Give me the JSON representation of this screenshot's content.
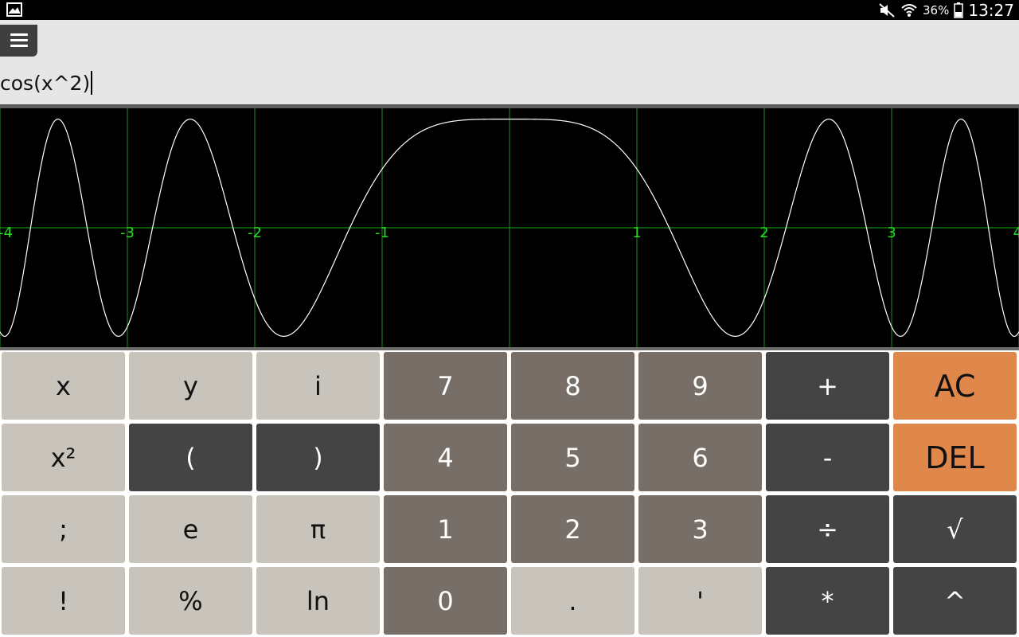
{
  "status_bar": {
    "left_icon": "gallery-icon",
    "icons": [
      "mute-icon",
      "wifi-icon",
      "battery-icon"
    ],
    "battery": "36%",
    "time": "13:27"
  },
  "toolbar": {
    "menu_icon": "menu-icon"
  },
  "input": {
    "expression": "cos(x^2)"
  },
  "graph": {
    "function": "cos(x^2)",
    "x_range": [
      -4,
      4
    ],
    "y_range": [
      -1.1,
      1.1
    ],
    "x_tick_labels": [
      "-4",
      "-3",
      "-2",
      "-1",
      "1",
      "2",
      "3",
      "4"
    ],
    "colors": {
      "background": "#000000",
      "grid": "#1f8a1f",
      "axis": "#1faf1f",
      "labels": "#22dd22",
      "curve": "#ffffff"
    }
  },
  "keypad": {
    "rows": [
      [
        {
          "label": "x",
          "style": "light",
          "name": "key-x"
        },
        {
          "label": "y",
          "style": "light",
          "name": "key-y"
        },
        {
          "label": "i",
          "style": "light",
          "name": "key-i"
        },
        {
          "label": "7",
          "style": "mid",
          "name": "key-7"
        },
        {
          "label": "8",
          "style": "mid",
          "name": "key-8"
        },
        {
          "label": "9",
          "style": "mid",
          "name": "key-9"
        },
        {
          "label": "+",
          "style": "dark",
          "name": "key-plus"
        },
        {
          "label": "AC",
          "style": "orange",
          "name": "key-all-clear"
        }
      ],
      [
        {
          "label": "x²",
          "style": "light",
          "name": "key-square"
        },
        {
          "label": "(",
          "style": "dark",
          "name": "key-open-paren"
        },
        {
          "label": ")",
          "style": "dark",
          "name": "key-close-paren"
        },
        {
          "label": "4",
          "style": "mid",
          "name": "key-4"
        },
        {
          "label": "5",
          "style": "mid",
          "name": "key-5"
        },
        {
          "label": "6",
          "style": "mid",
          "name": "key-6"
        },
        {
          "label": "-",
          "style": "dark",
          "name": "key-minus"
        },
        {
          "label": "DEL",
          "style": "orange",
          "name": "key-delete"
        }
      ],
      [
        {
          "label": ";",
          "style": "light",
          "name": "key-semicolon"
        },
        {
          "label": "e",
          "style": "light",
          "name": "key-e"
        },
        {
          "label": "π",
          "style": "light",
          "name": "key-pi"
        },
        {
          "label": "1",
          "style": "mid",
          "name": "key-1"
        },
        {
          "label": "2",
          "style": "mid",
          "name": "key-2"
        },
        {
          "label": "3",
          "style": "mid",
          "name": "key-3"
        },
        {
          "label": "÷",
          "style": "dark",
          "name": "key-divide"
        },
        {
          "label": "√",
          "style": "dark",
          "name": "key-sqrt"
        }
      ],
      [
        {
          "label": "!",
          "style": "light",
          "name": "key-factorial"
        },
        {
          "label": "%",
          "style": "light",
          "name": "key-percent"
        },
        {
          "label": "ln",
          "style": "light",
          "name": "key-ln"
        },
        {
          "label": "0",
          "style": "mid",
          "name": "key-0"
        },
        {
          "label": ".",
          "style": "light",
          "name": "key-decimal"
        },
        {
          "label": "'",
          "style": "light",
          "name": "key-apostrophe"
        },
        {
          "label": "*",
          "style": "dark",
          "name": "key-multiply"
        },
        {
          "label": "^",
          "style": "dark",
          "name": "key-power"
        }
      ]
    ]
  }
}
